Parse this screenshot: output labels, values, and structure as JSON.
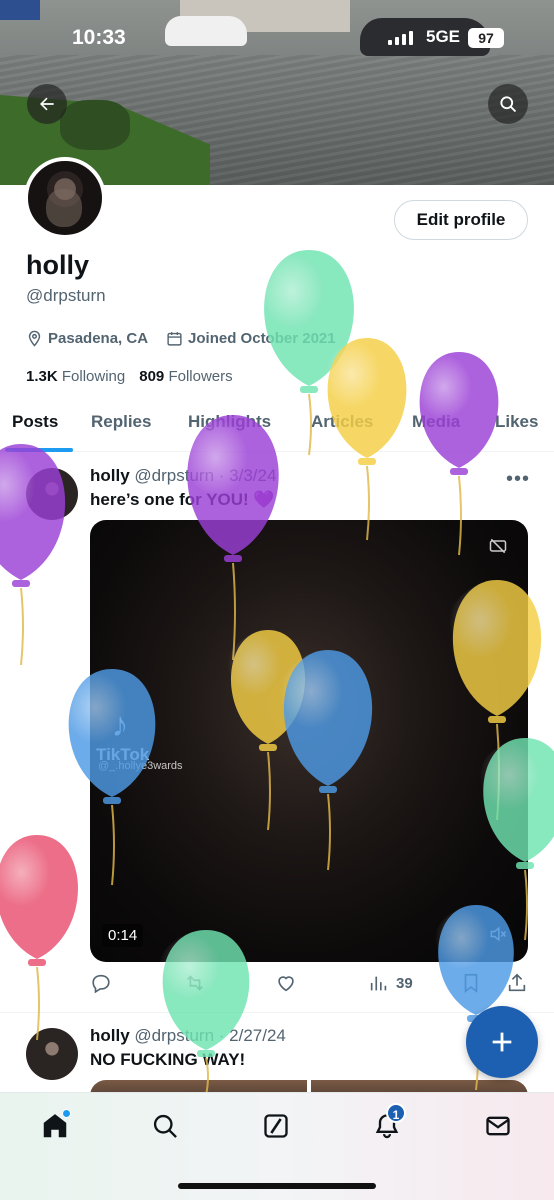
{
  "status_bar": {
    "time": "10:33",
    "network": "5GE",
    "battery": "97"
  },
  "profile": {
    "display_name": "holly",
    "handle": "@drpsturn",
    "edit_label": "Edit profile",
    "location": "Pasadena, CA",
    "joined": "Joined October 2021",
    "following_count": "1.3K",
    "following_label": "Following",
    "followers_count": "809",
    "followers_label": "Followers"
  },
  "tabs": [
    {
      "label": "Posts",
      "active": true
    },
    {
      "label": "Replies"
    },
    {
      "label": "Highlights"
    },
    {
      "label": "Articles"
    },
    {
      "label": "Media"
    },
    {
      "label": "Likes"
    }
  ],
  "posts": [
    {
      "name": "holly",
      "handle": "@drpsturn",
      "date": "· 3/3/24",
      "text": "here’s one for YOU! 💜",
      "video": {
        "watermark": "TikTok",
        "tiktok_user": "@_.hollye3wards",
        "duration": "0:14"
      },
      "views": "39"
    },
    {
      "name": "holly",
      "handle": "@drpsturn",
      "date": "· 2/27/24",
      "text": "NO FUCKING WAY!"
    }
  ],
  "bottom_nav": {
    "notifications_badge": "1"
  },
  "icons": [
    "back-arrow-icon",
    "search-icon",
    "location-pin-icon",
    "calendar-icon",
    "more-icon",
    "reply-icon",
    "repost-icon",
    "like-icon",
    "views-icon",
    "bookmark-icon",
    "share-icon",
    "compose-icon",
    "home-icon",
    "grok-icon",
    "bell-icon",
    "mail-icon"
  ],
  "colors": {
    "accent": "#1d9bf0",
    "fab": "#1d5fb0",
    "text": "#0f1419",
    "secondary": "#536471"
  }
}
